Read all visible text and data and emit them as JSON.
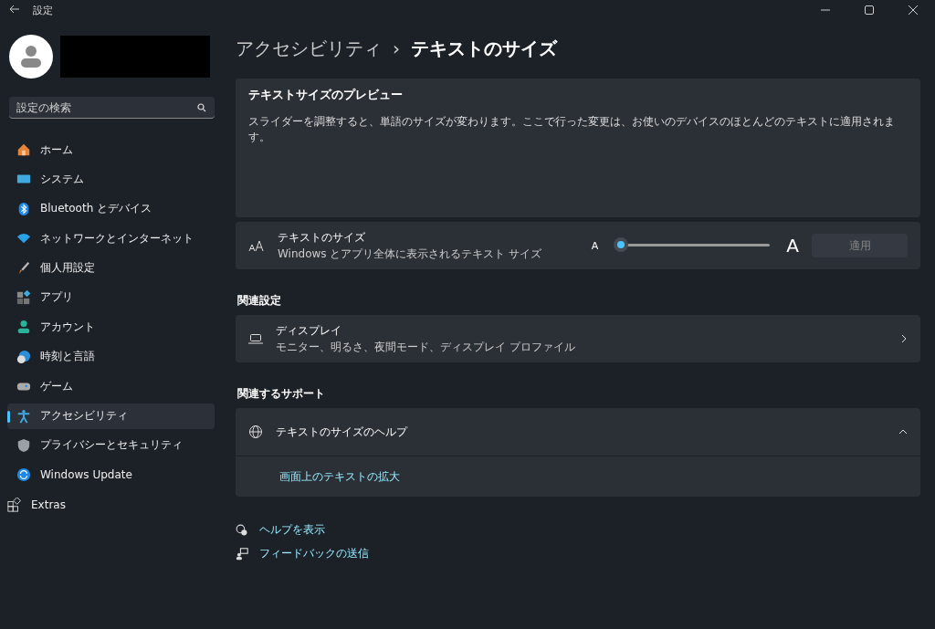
{
  "window": {
    "title": "設定"
  },
  "sidebar": {
    "search": {
      "placeholder": "設定の検索"
    },
    "items": [
      {
        "label": "ホーム",
        "selected": false
      },
      {
        "label": "システム",
        "selected": false
      },
      {
        "label": "Bluetooth とデバイス",
        "selected": false
      },
      {
        "label": "ネットワークとインターネット",
        "selected": false
      },
      {
        "label": "個人用設定",
        "selected": false
      },
      {
        "label": "アプリ",
        "selected": false
      },
      {
        "label": "アカウント",
        "selected": false
      },
      {
        "label": "時刻と言語",
        "selected": false
      },
      {
        "label": "ゲーム",
        "selected": false
      },
      {
        "label": "アクセシビリティ",
        "selected": true
      },
      {
        "label": "プライバシーとセキュリティ",
        "selected": false
      },
      {
        "label": "Windows Update",
        "selected": false
      },
      {
        "label": "Extras",
        "selected": false
      }
    ]
  },
  "breadcrumb": {
    "parent": "アクセシビリティ",
    "separator": "›",
    "current": "テキストのサイズ"
  },
  "preview": {
    "title": "テキストサイズのプレビュー",
    "text": "スライダーを調整すると、単語のサイズが変わります。ここで行った変更は、お使いのデバイスのほとんどのテキストに適用されます。"
  },
  "text_size": {
    "title": "テキストのサイズ",
    "subtitle": "Windows とアプリ全体に表示されるテキスト サイズ",
    "small_label": "A",
    "large_label": "A",
    "level": 0.04,
    "apply_button": {
      "label": "適用",
      "disabled": true
    }
  },
  "related_settings": {
    "heading": "関連設定",
    "items": [
      {
        "title": "ディスプレイ",
        "subtitle": "モニター、明るさ、夜間モード、ディスプレイ プロファイル"
      }
    ]
  },
  "related_support": {
    "heading": "関連するサポート",
    "title": "テキストのサイズのヘルプ",
    "expanded": true,
    "links": [
      "画面上のテキストの拡大"
    ]
  },
  "footer_links": [
    "ヘルプを表示",
    "フィードバックの送信"
  ]
}
